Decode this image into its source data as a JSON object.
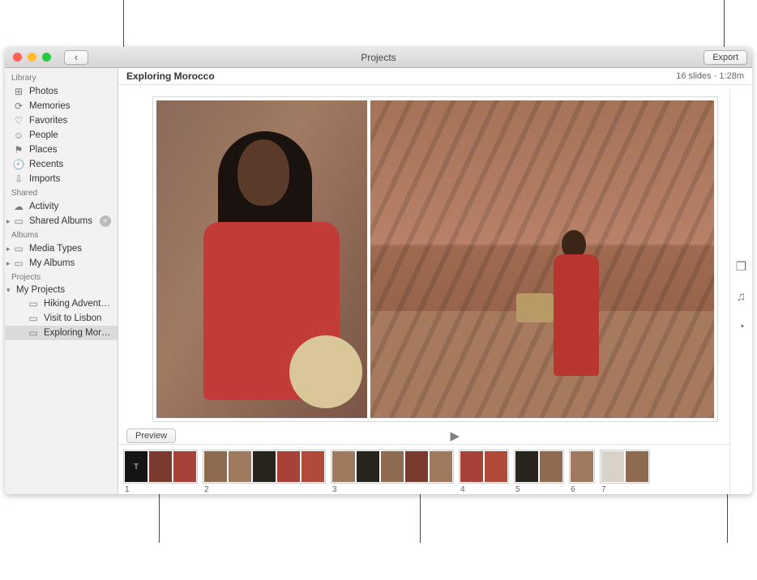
{
  "titlebar": {
    "title": "Projects",
    "back_glyph": "‹",
    "export_label": "Export"
  },
  "sidebar": {
    "sections": {
      "library": "Library",
      "shared": "Shared",
      "albums": "Albums",
      "projects": "Projects"
    },
    "library_items": [
      {
        "label": "Photos",
        "icon": "⊞"
      },
      {
        "label": "Memories",
        "icon": "⟳"
      },
      {
        "label": "Favorites",
        "icon": "♡"
      },
      {
        "label": "People",
        "icon": "☺"
      },
      {
        "label": "Places",
        "icon": "⚑"
      },
      {
        "label": "Recents",
        "icon": "🕘"
      },
      {
        "label": "Imports",
        "icon": "⇩"
      }
    ],
    "shared_items": [
      {
        "label": "Activity",
        "icon": "☁"
      },
      {
        "label": "Shared Albums",
        "icon": "▭",
        "disclose": true,
        "add": true
      }
    ],
    "albums_items": [
      {
        "label": "Media Types",
        "icon": "▭",
        "disclose": true
      },
      {
        "label": "My Albums",
        "icon": "▭",
        "disclose": true
      }
    ],
    "projects_root": {
      "label": "My Projects",
      "disclose": true,
      "open": true
    },
    "projects_children": [
      {
        "label": "Hiking Adventure",
        "icon": "▭"
      },
      {
        "label": "Visit to Lisbon",
        "icon": "▭"
      },
      {
        "label": "Exploring Moroc…",
        "icon": "▭",
        "selected": true
      }
    ]
  },
  "project": {
    "title": "Exploring Morocco",
    "meta": "16 slides · 1:28m"
  },
  "controls": {
    "preview": "Preview",
    "play_glyph": "▶",
    "share_glyph": "⇪"
  },
  "right_tools": {
    "themes_glyph": "❐",
    "music_glyph": "♫",
    "timing_glyph": "◔",
    "add_glyph": "+"
  },
  "filmstrip": {
    "title_thumb": "T",
    "slides": [
      {
        "num": "1",
        "thumbs": 3
      },
      {
        "num": "2",
        "thumbs": 5
      },
      {
        "num": "3",
        "thumbs": 5
      },
      {
        "num": "4",
        "thumbs": 2
      },
      {
        "num": "5",
        "thumbs": 2
      },
      {
        "num": "6",
        "thumbs": 1
      },
      {
        "num": "7",
        "thumbs": 2
      }
    ]
  }
}
